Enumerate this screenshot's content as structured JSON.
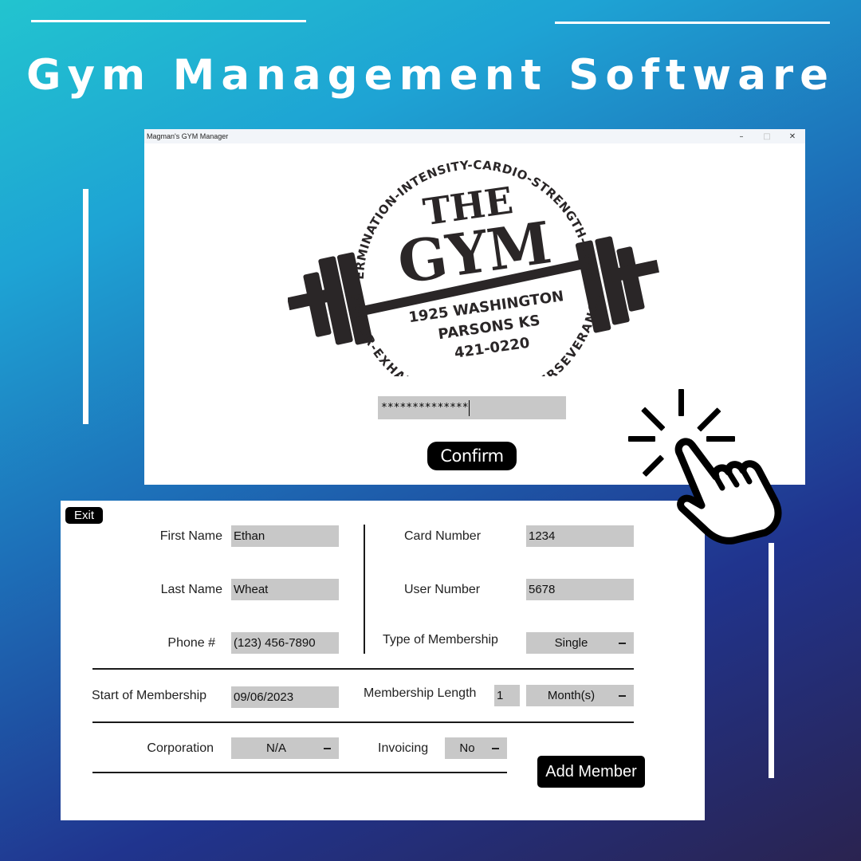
{
  "headline": "Gym Management Software",
  "login_window": {
    "title": "Magman's GYM Manager",
    "controls": {
      "minimize": "–",
      "maximize": "□",
      "close": "✕"
    },
    "logo": {
      "top_arc": "DETERMINATION-INTENSITY-CARDIO-STRENGTH-STAMINA",
      "bottom_arc": "POWER-EXHAUSTION-SUCCESS-PERSEVERANCE",
      "word1": "THE",
      "word2": "GYM",
      "address_line1": "1925 WASHINGTON",
      "address_line2": "PARSONS KS",
      "phone": "421-0220"
    },
    "password_value": "**************",
    "confirm_label": "Confirm"
  },
  "member_form": {
    "exit_label": "Exit",
    "first_name": {
      "label": "First Name",
      "value": "Ethan"
    },
    "last_name": {
      "label": "Last Name",
      "value": "Wheat"
    },
    "phone": {
      "label": "Phone #",
      "value": "(123) 456-7890"
    },
    "card_number": {
      "label": "Card Number",
      "value": "1234"
    },
    "user_number": {
      "label": "User Number",
      "value": "5678"
    },
    "membership_type": {
      "label": "Type of Membership",
      "value": "Single"
    },
    "start_of_membership": {
      "label": "Start of Membership",
      "value": "09/06/2023"
    },
    "membership_length": {
      "label": "Membership Length",
      "value": "1",
      "unit": "Month(s)"
    },
    "corporation": {
      "label": "Corporation",
      "value": "N/A"
    },
    "invoicing": {
      "label": "Invoicing",
      "value": "No"
    },
    "add_member_label": "Add Member"
  },
  "icons": [
    "cursor-hand-click-icon"
  ],
  "colors": {
    "button": "#000000",
    "field": "#c8c8c8",
    "text": "#ffffff"
  }
}
